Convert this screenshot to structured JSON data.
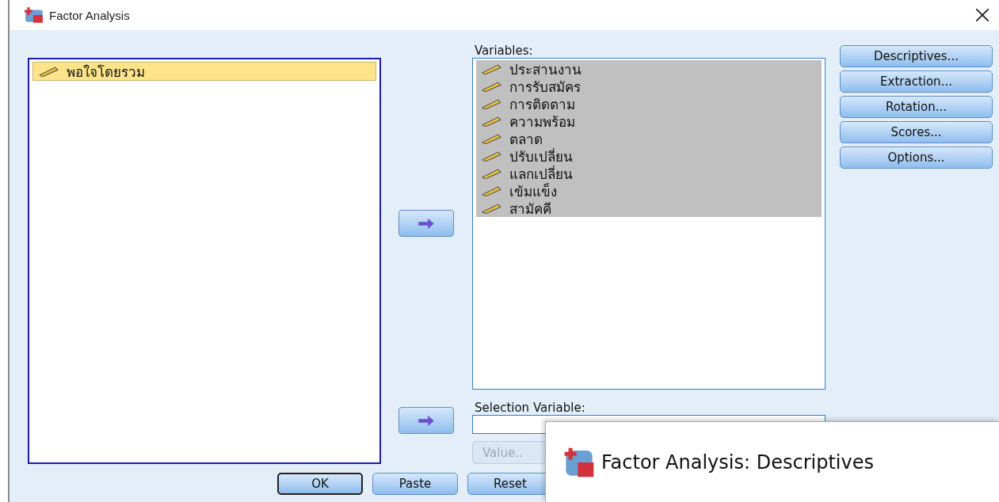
{
  "window": {
    "title": "Factor Analysis"
  },
  "source_list": {
    "items": [
      {
        "label": "พอใจโดยรวม",
        "selected": true
      }
    ]
  },
  "variables": {
    "label": "Variables:",
    "items": [
      {
        "label": "ประสานงาน",
        "selected": true
      },
      {
        "label": "การรับสมัคร",
        "selected": true
      },
      {
        "label": "การติดตาม",
        "selected": true
      },
      {
        "label": "ความพร้อม",
        "selected": true
      },
      {
        "label": "ตลาด",
        "selected": true
      },
      {
        "label": "ปรับเปลี่ยน",
        "selected": true
      },
      {
        "label": "แลกเปลี่ยน",
        "selected": true
      },
      {
        "label": "เข้มแข็ง",
        "selected": true
      },
      {
        "label": "สามัคคี",
        "selected": true
      }
    ]
  },
  "side_buttons": [
    "Descriptives...",
    "Extraction...",
    "Rotation...",
    "Scores...",
    "Options..."
  ],
  "selection_variable": {
    "label": "Selection Variable:",
    "value_button": {
      "label": "Value..",
      "disabled": true
    }
  },
  "bottom_buttons": [
    {
      "label": "OK",
      "default": true
    },
    {
      "label": "Paste",
      "default": false
    },
    {
      "label": "Reset",
      "default": false
    }
  ],
  "overlay_window": {
    "title": "Factor Analysis: Descriptives"
  }
}
